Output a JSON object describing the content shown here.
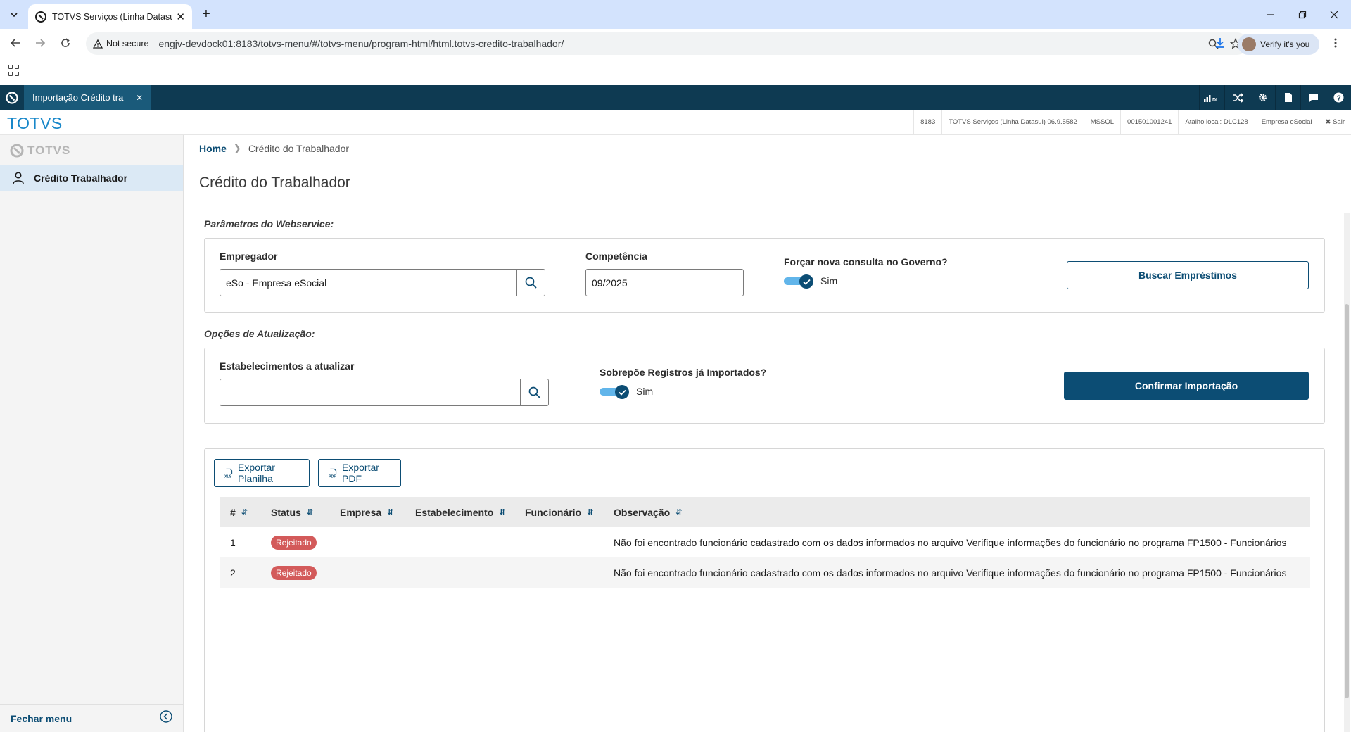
{
  "browser": {
    "tab_title": "TOTVS Serviços (Linha Datasul)",
    "not_secure": "Not secure",
    "url": "engjv-devdock01:8183/totvs-menu/#/totvs-menu/program-html/html.totvs-credito-trabalhador/",
    "profile_label": "Verify it's you"
  },
  "app": {
    "tab_label": "Importação Crédito tra",
    "brand": "TOTVS",
    "info": [
      "8183",
      "TOTVS Serviços (Linha Datasul) 06.9.5582",
      "MSSQL",
      "001501001241",
      "Atalho local: DLC128",
      "Empresa eSocial",
      "✖ Sair"
    ],
    "toolbar_icons": [
      "signal-di-icon",
      "shuffle-icon",
      "gear-icon",
      "document-icon",
      "chat-icon",
      "help-icon"
    ]
  },
  "sidebar": {
    "logo_text": "TOTVS",
    "items": [
      {
        "label": "Crédito Trabalhador",
        "icon": "user-icon"
      }
    ],
    "close_label": "Fechar menu"
  },
  "main": {
    "breadcrumb": {
      "home": "Home",
      "current": "Crédito do Trabalhador"
    },
    "title": "Crédito do Trabalhador",
    "webservice": {
      "section": "Parâmetros do Webservice:",
      "employer_label": "Empregador",
      "employer_value": "eSo - Empresa eSocial",
      "competence_label": "Competência",
      "competence_value": "09/2025",
      "force_label": "Forçar nova consulta no Governo?",
      "force_value": "Sim",
      "search_button": "Buscar Empréstimos"
    },
    "update": {
      "section": "Opções de Atualização:",
      "establishments_label": "Estabelecimentos a atualizar",
      "establishments_value": "",
      "overwrite_label": "Sobrepõe Registros já Importados?",
      "overwrite_value": "Sim",
      "confirm_button": "Confirmar Importação"
    },
    "results": {
      "export_sheet": "Exportar Planilha",
      "export_pdf": "Exportar PDF",
      "columns": [
        "#",
        "Status",
        "Empresa",
        "Estabelecimento",
        "Funcionário",
        "Observação"
      ],
      "rows": [
        {
          "num": "1",
          "status": "Rejeitado",
          "empresa": "",
          "estabelecimento": "",
          "funcionario": "",
          "observacao": "Não foi encontrado funcionário cadastrado com os dados informados no arquivo Verifique informações do funcionário no programa FP1500 - Funcionários"
        },
        {
          "num": "2",
          "status": "Rejeitado",
          "empresa": "",
          "estabelecimento": "",
          "funcionario": "",
          "observacao": "Não foi encontrado funcionário cadastrado com os dados informados no arquivo Verifique informações do funcionário no programa FP1500 - Funcionários"
        }
      ]
    }
  },
  "colors": {
    "app_bar": "#0e3a52",
    "primary": "#0c4d74",
    "brand": "#1887c9",
    "switch_track": "#61b5ea",
    "badge_rejected": "#d35a5a"
  }
}
